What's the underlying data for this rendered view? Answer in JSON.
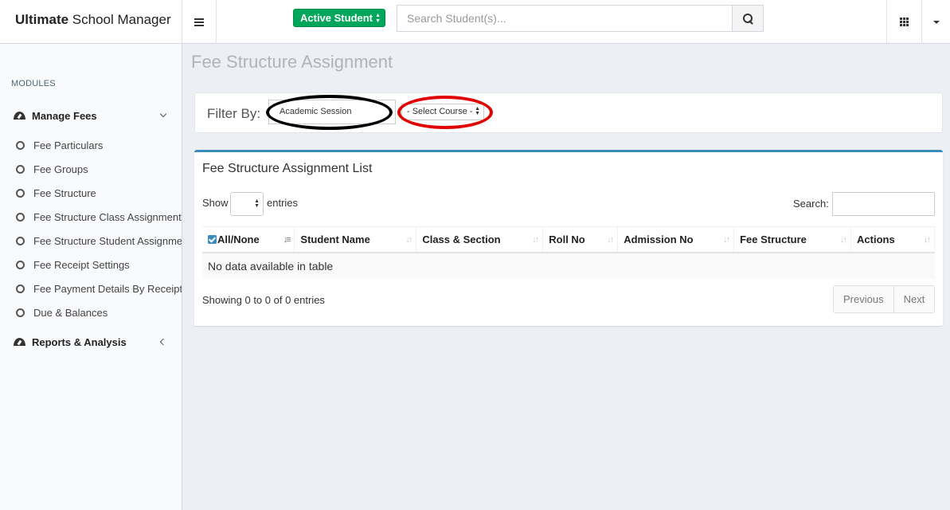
{
  "header": {
    "logo_bold": "Ultimate",
    "logo_rest": " School Manager",
    "status_select": "Active Student",
    "search_placeholder": "Search Student(s)..."
  },
  "sidebar": {
    "section_heading": "MODULES",
    "group_manage": "Manage Fees",
    "items": [
      {
        "label": "Fee Particulars"
      },
      {
        "label": "Fee Groups"
      },
      {
        "label": "Fee Structure"
      },
      {
        "label": "Fee Structure Class Assignment"
      },
      {
        "label": "Fee Structure Student Assignme"
      },
      {
        "label": "Fee Receipt Settings"
      },
      {
        "label": "Fee Payment Details By Receipt I"
      },
      {
        "label": "Due & Balances"
      }
    ],
    "group_reports": "Reports & Analysis"
  },
  "page": {
    "title": "Fee Structure Assignment"
  },
  "filter": {
    "label": "Filter By:",
    "session_value": "Academic Session",
    "course_value": "- Select Course -"
  },
  "list": {
    "title": "Fee Structure Assignment List",
    "show_label": "Show",
    "entries_label": "entries",
    "search_label": "Search:",
    "columns": [
      "All/None",
      "Student Name",
      "Class & Section",
      "Roll No",
      "Admission No",
      "Fee Structure",
      "Actions"
    ],
    "empty_text": "No data available in table",
    "info": "Showing 0 to 0 of 0 entries",
    "prev": "Previous",
    "next": "Next"
  }
}
